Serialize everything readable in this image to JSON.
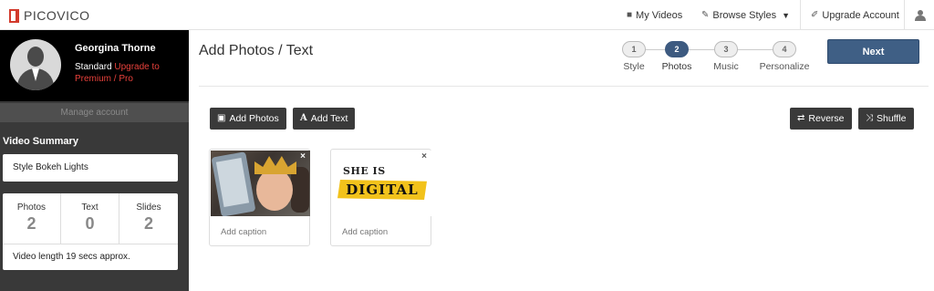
{
  "app": {
    "name": "PICOVICO",
    "brand_color": "#d23a2c"
  },
  "nav": {
    "my_videos": {
      "label": "My Videos",
      "icon": "video-camera-icon"
    },
    "browse_styles": {
      "label": "Browse Styles",
      "icon": "brush-icon",
      "caret": "▼"
    },
    "upgrade": {
      "label": "Upgrade Account",
      "icon": "feather-icon"
    },
    "user_icon": "user-icon"
  },
  "sidebar": {
    "user_name": "Georgina Thorne",
    "plan": "Standard",
    "upgrade_link": "Upgrade to Premium / Pro",
    "manage_account": "Manage account",
    "summary_title": "Video Summary",
    "style_text": "Style Bokeh Lights",
    "stats": [
      {
        "label": "Photos",
        "value": "2"
      },
      {
        "label": "Text",
        "value": "0"
      },
      {
        "label": "Slides",
        "value": "2"
      }
    ],
    "video_length": "Video length 19 secs approx."
  },
  "main": {
    "title": "Add Photos / Text",
    "steps": [
      {
        "num": "1",
        "label": "Style",
        "active": false
      },
      {
        "num": "2",
        "label": "Photos",
        "active": true
      },
      {
        "num": "3",
        "label": "Music",
        "active": false
      },
      {
        "num": "4",
        "label": "Personalize",
        "active": false
      }
    ],
    "next_label": "Next",
    "add_photos": "Add Photos",
    "add_text": "Add Text",
    "reverse": "Reverse",
    "shuffle": "Shuffle",
    "cards": [
      {
        "caption_placeholder": "Add caption",
        "close": "×"
      },
      {
        "caption_placeholder": "Add caption",
        "close": "×",
        "text_line1": "SHE IS",
        "text_line2": "DIGITAL"
      }
    ]
  }
}
